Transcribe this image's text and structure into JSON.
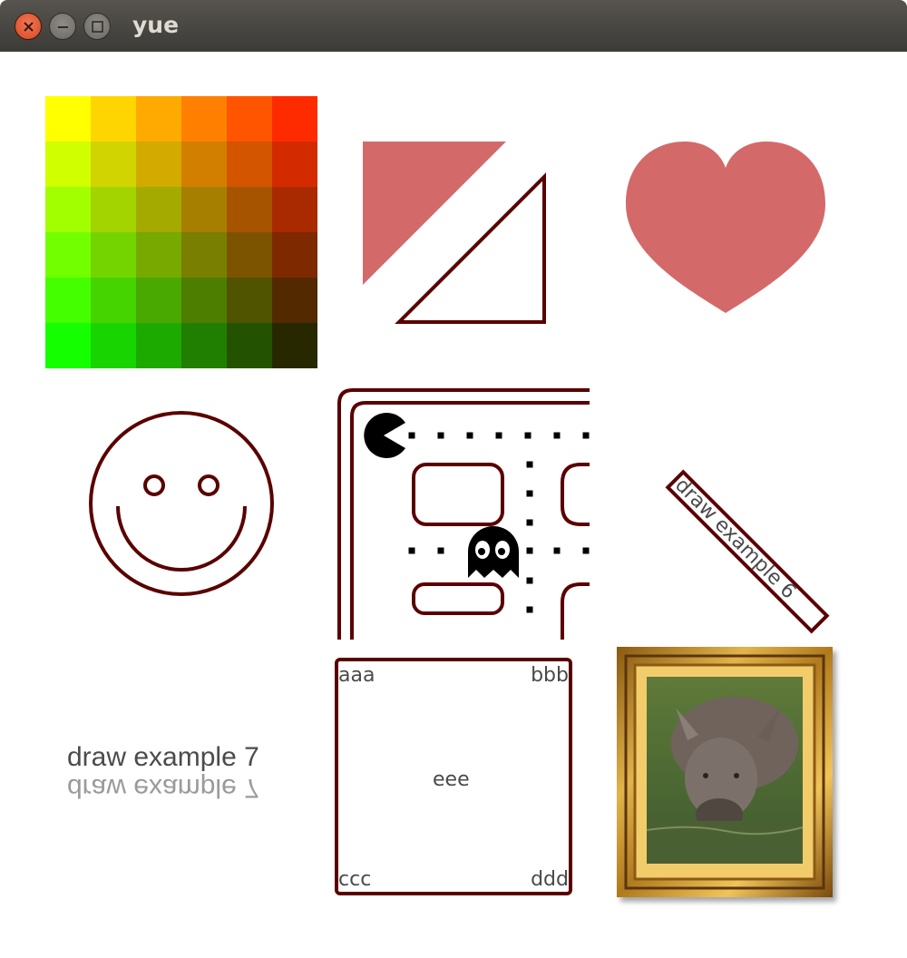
{
  "window": {
    "title": "yue",
    "buttons": [
      "close",
      "minimize",
      "maximize"
    ]
  },
  "colors": {
    "stroke": "#5a0000",
    "fill": "#d4696a",
    "text": "#4a4a4a",
    "reflection": "#9a9a9a",
    "titlebar": "#3c3b37",
    "close": "#e9552c"
  },
  "examples": {
    "rotated_text": "draw example 6",
    "text7": "draw example 7",
    "text7_reflection": "draw example 7",
    "box8": {
      "top_left": "aaa",
      "top_right": "bbb",
      "center": "eee",
      "bottom_left": "ccc",
      "bottom_right": "ddd"
    },
    "image": "framed-rhino-picture"
  }
}
